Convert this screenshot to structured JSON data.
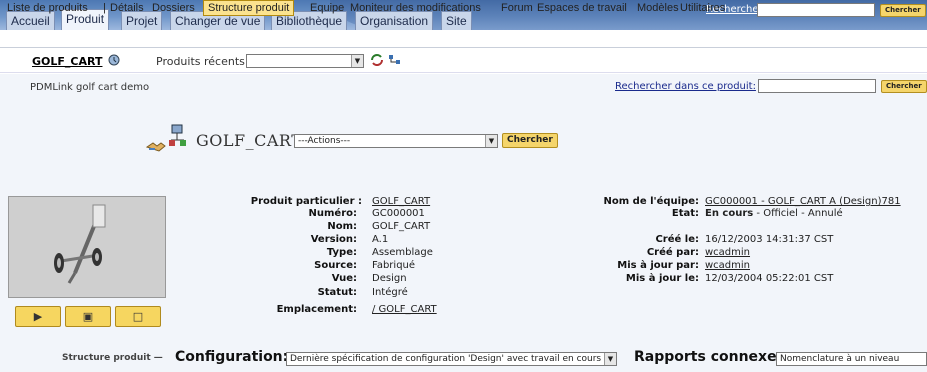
{
  "tabs": [
    {
      "label": "Accueil",
      "active": false
    },
    {
      "label": "Produit",
      "active": true
    },
    {
      "label": "Projet",
      "active": false
    },
    {
      "label": "Changer de vue",
      "active": false
    },
    {
      "label": "Bibliothèque",
      "active": false
    },
    {
      "label": "Organisation",
      "active": false
    },
    {
      "label": "Site",
      "active": false
    }
  ],
  "search": {
    "link": "Recherche :",
    "button": "Chercher"
  },
  "subnav": {
    "items": [
      "Liste de produits",
      "Détails",
      "Dossiers",
      "Structure produit",
      "Equipe",
      "Moniteur des modifications",
      "Forum",
      "Espaces de travail",
      "Modèles",
      "Utilitaires"
    ],
    "separator": "|",
    "active": "Structure produit"
  },
  "product_bar": {
    "product": "GOLF_CART",
    "recent_label": "Produits récents:",
    "recent_value": ""
  },
  "context": {
    "description": "PDMLink golf cart demo",
    "search_link": "Rechercher dans ce produit:",
    "search_button": "Chercher"
  },
  "header": {
    "title": "GOLF_CART",
    "actions": "---Actions---",
    "button": "Chercher"
  },
  "thumbnail_buttons": [
    "view-icon",
    "print-icon",
    "folder-icon"
  ],
  "attributes_left": [
    {
      "label": "Produit particulier :",
      "value": "GOLF_CART",
      "link": true
    },
    {
      "label": "Numéro:",
      "value": "GC000001",
      "link": false
    },
    {
      "label": "Nom:",
      "value": "GOLF_CART",
      "link": false
    },
    {
      "label": "Version:",
      "value": "A.1",
      "link": false
    },
    {
      "label": "Type:",
      "value": "Assemblage",
      "link": false
    },
    {
      "label": "Source:",
      "value": "Fabriqué",
      "link": false
    },
    {
      "label": "Vue:",
      "value": "Design",
      "link": false
    },
    {
      "label": "Statut:",
      "value": "Intégré",
      "link": false
    },
    {
      "label": "Emplacement:",
      "value": "/ GOLF_CART",
      "link": true
    }
  ],
  "attributes_right": [
    {
      "label": "Nom de l'équipe:",
      "value": "GC000001 - GOLF_CART A (Design)781",
      "link": true
    },
    {
      "label": "Etat:",
      "value": "En cours",
      "extra": " - Officiel - Annulé",
      "link": false
    },
    {
      "label": "",
      "value": "",
      "link": false
    },
    {
      "label": "Créé le:",
      "value": "16/12/2003 14:31:37 CST",
      "link": false
    },
    {
      "label": "Créé par:",
      "value": "wcadmin",
      "link": true
    },
    {
      "label": "Mis à jour par:",
      "value": "wcadmin",
      "link": true
    },
    {
      "label": "Mis à jour le:",
      "value": "12/03/2004 05:22:01 CST",
      "link": false
    }
  ],
  "bottom": {
    "section_label": "Structure produit —",
    "config_label": "Configuration:",
    "config_value": "Dernière spécification de configuration 'Design' avec travail en cours",
    "reports_label": "Rapports connexes:",
    "reports_value": "Nomenclature à un niveau"
  },
  "colors": {
    "band": "#5a82bb",
    "button": "#f5d56b",
    "active_sub": "#fbe38f",
    "link": "#1a2a8c"
  }
}
